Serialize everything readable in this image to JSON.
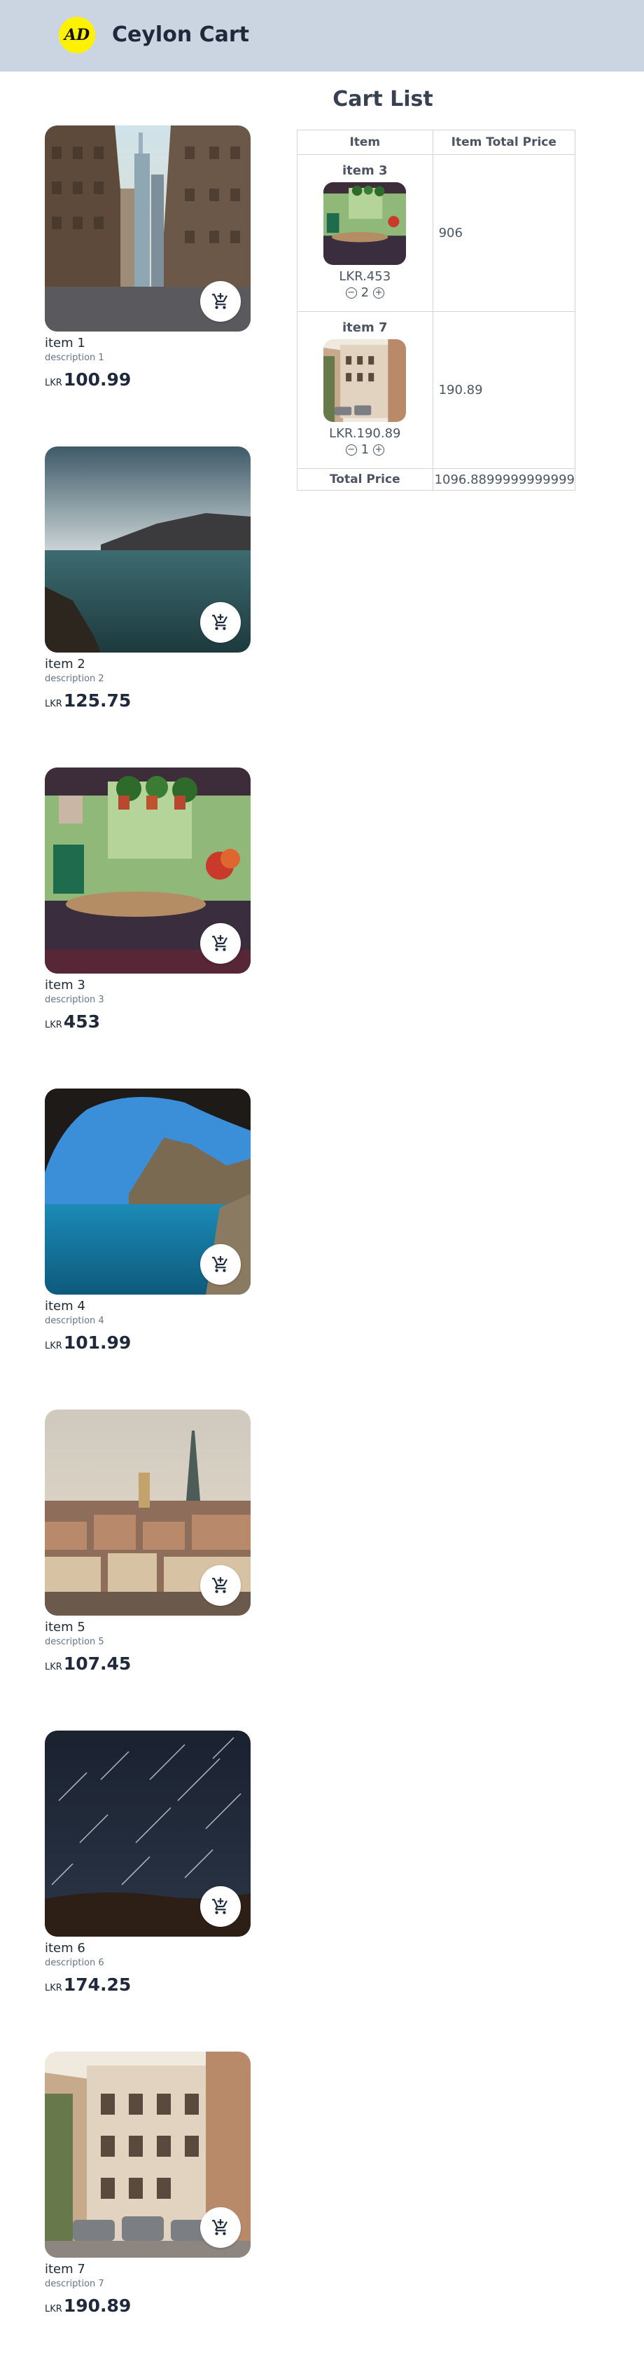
{
  "header": {
    "logo_text": "AD",
    "brand": "Ceylon Cart"
  },
  "products": [
    {
      "name": "item 1",
      "description": "description 1",
      "currency": "LKR",
      "price": "100.99"
    },
    {
      "name": "item 2",
      "description": "description 2",
      "currency": "LKR",
      "price": "125.75"
    },
    {
      "name": "item 3",
      "description": "description 3",
      "currency": "LKR",
      "price": "453"
    },
    {
      "name": "item 4",
      "description": "description 4",
      "currency": "LKR",
      "price": "101.99"
    },
    {
      "name": "item 5",
      "description": "description 5",
      "currency": "LKR",
      "price": "107.45"
    },
    {
      "name": "item 6",
      "description": "description 6",
      "currency": "LKR",
      "price": "174.25"
    },
    {
      "name": "item 7",
      "description": "description 7",
      "currency": "LKR",
      "price": "190.89"
    }
  ],
  "cart": {
    "title": "Cart List",
    "headers": {
      "item": "Item",
      "total": "Item Total Price"
    },
    "items": [
      {
        "name": "item 3",
        "price": "LKR.453",
        "qty": "2",
        "total": "906"
      },
      {
        "name": "item 7",
        "price": "LKR.190.89",
        "qty": "1",
        "total": "190.89"
      }
    ],
    "total_label": "Total Price",
    "total_value": "1096.8899999999999"
  },
  "icons": {
    "cart": "add-shopping-cart-icon",
    "decrement": "minus-circle-icon",
    "increment": "plus-circle-icon"
  }
}
